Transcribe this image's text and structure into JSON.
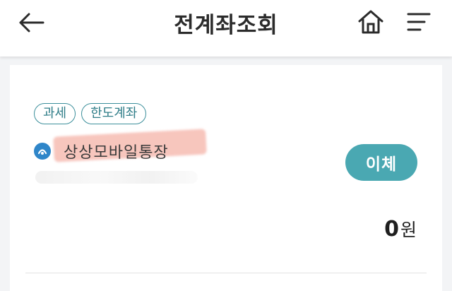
{
  "header": {
    "title": "전계좌조회",
    "back_icon": "arrow-left-icon",
    "home_icon": "home-icon",
    "menu_icon": "hamburger-menu-icon"
  },
  "account": {
    "tags": [
      "과세",
      "한도계좌"
    ],
    "bank_icon": "bank-logo-icon",
    "name": "상상모바일통장",
    "transfer_label": "이체",
    "balance_amount": "0",
    "balance_unit": "원"
  },
  "colors": {
    "accent": "#4aa8b2",
    "tag_border": "#3c8f9b",
    "highlight": "#f5b3a8"
  }
}
